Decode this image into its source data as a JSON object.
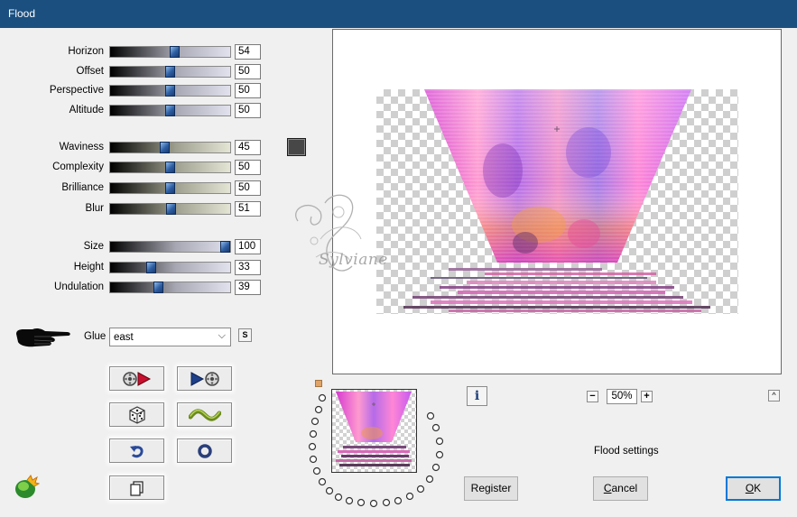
{
  "window": {
    "title": "Flood"
  },
  "sliders_group1": [
    {
      "label": "Horizon",
      "value": "54",
      "level_percent": 54
    },
    {
      "label": "Offset",
      "value": "50",
      "level_percent": 50
    },
    {
      "label": "Perspective",
      "value": "50",
      "level_percent": 50
    },
    {
      "label": "Altitude",
      "value": "50",
      "level_percent": 50
    }
  ],
  "sliders_group2": [
    {
      "label": "Waviness",
      "value": "45",
      "level_percent": 45
    },
    {
      "label": "Complexity",
      "value": "50",
      "level_percent": 50
    },
    {
      "label": "Brilliance",
      "value": "50",
      "level_percent": 50
    },
    {
      "label": "Blur",
      "value": "51",
      "level_percent": 51
    }
  ],
  "sliders_group3": [
    {
      "label": "Size",
      "value": "100",
      "level_percent": 100
    },
    {
      "label": "Height",
      "value": "33",
      "level_percent": 33
    },
    {
      "label": "Undulation",
      "value": "39",
      "level_percent": 39
    }
  ],
  "wave_color": "#474747",
  "glue": {
    "label": "Glue",
    "selected": "east",
    "s_button": "S"
  },
  "tool_buttons": [
    "film-reel-forward-icon",
    "forward-film-reel-icon",
    "dice-icon",
    "wave-icon",
    "undo-arrow-icon",
    "reset-ring-icon",
    "copy-pages-icon"
  ],
  "watermark": {
    "text": "Sylviane"
  },
  "preview": {
    "zoom": "50%",
    "zoom_minus": "−",
    "zoom_plus": "+",
    "info": "i",
    "expand": "^"
  },
  "status_text": "Flood settings",
  "buttons": {
    "register": "Register",
    "cancel_pre": "",
    "cancel_u": "C",
    "cancel_post": "ancel",
    "ok_u": "O",
    "ok_post": "K"
  },
  "colors": {
    "titlebar": "#1b4f80",
    "default_button_border": "#0078d7",
    "slider_thumb": "#2d5da0"
  }
}
